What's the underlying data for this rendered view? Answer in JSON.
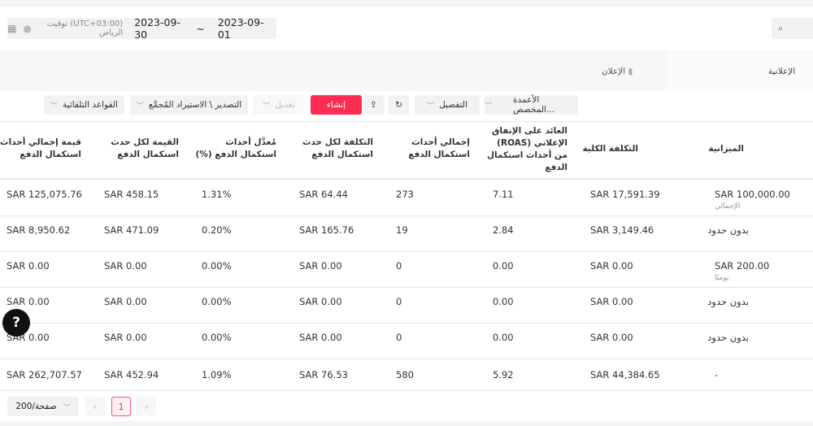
{
  "date_range": {
    "start": "2023-09-01",
    "separator": "~",
    "end": "2023-09-30",
    "timezone": "(UTC+03:00) توقيت الرياض"
  },
  "tabs": [
    {
      "label": "الإعلان"
    },
    {
      "label": "الإعلانية"
    }
  ],
  "toolbar": {
    "custom_columns": "الأعمدة المخصص...",
    "breakdown": "التفصيل",
    "create": "إنشاء",
    "edit": "تعديل",
    "export": "التصدير \\ الاستيراد المُجمَّع",
    "rules": "القواعد التلقائية"
  },
  "columns": [
    "الميزانية",
    "التكلفة الكلية",
    "العائد على الإنفاق الإعلاني (ROAS) من أحداث استكمال الدفع",
    "إجمالي أحداث استكمال الدفع",
    "التكلفة لكل حدث استكمال الدفع",
    "مُعدَّل أحداث استكمال الدفع (%)",
    "القيمة لكل حدث استكمال الدفع",
    "قيمة إجمالي أحداث استكمال الدفع"
  ],
  "rows": [
    {
      "budget": "SAR 100,000.00",
      "budget_sub": "الإجمالي",
      "cost": "SAR 17,591.39",
      "roas": "7.11",
      "events": "273",
      "cpe": "SAR 64.44",
      "rate": "1.31%",
      "vpe": "SAR 458.15",
      "total_value": "SAR 125,075.76"
    },
    {
      "budget": "بدون حدود",
      "budget_sub": "",
      "cost": "SAR 3,149.46",
      "roas": "2.84",
      "events": "19",
      "cpe": "SAR 165.76",
      "rate": "0.20%",
      "vpe": "SAR 471.09",
      "total_value": "SAR 8,950.62"
    },
    {
      "budget": "SAR 200.00",
      "budget_sub": "يوميًا",
      "cost": "SAR 0.00",
      "roas": "0.00",
      "events": "0",
      "cpe": "SAR 0.00",
      "rate": "0.00%",
      "vpe": "SAR 0.00",
      "total_value": "SAR 0.00"
    },
    {
      "budget": "بدون حدود",
      "budget_sub": "",
      "cost": "SAR 0.00",
      "roas": "0.00",
      "events": "0",
      "cpe": "SAR 0.00",
      "rate": "0.00%",
      "vpe": "SAR 0.00",
      "total_value": "SAR 0.00"
    },
    {
      "budget": "بدون حدود",
      "budget_sub": "",
      "cost": "SAR 0.00",
      "roas": "0.00",
      "events": "0",
      "cpe": "SAR 0.00",
      "rate": "0.00%",
      "vpe": "SAR 0.00",
      "total_value": "SAR 0.00"
    }
  ],
  "total": {
    "budget": "-",
    "cost": "SAR 44,384.65",
    "roas": "5.92",
    "events": "580",
    "cpe": "SAR 76.53",
    "rate": "1.09%",
    "vpe": "SAR 452.94",
    "total_value": "SAR 262,707.57"
  },
  "pagination": {
    "page_size": "200/صفحة",
    "current": "1"
  },
  "help": "?"
}
